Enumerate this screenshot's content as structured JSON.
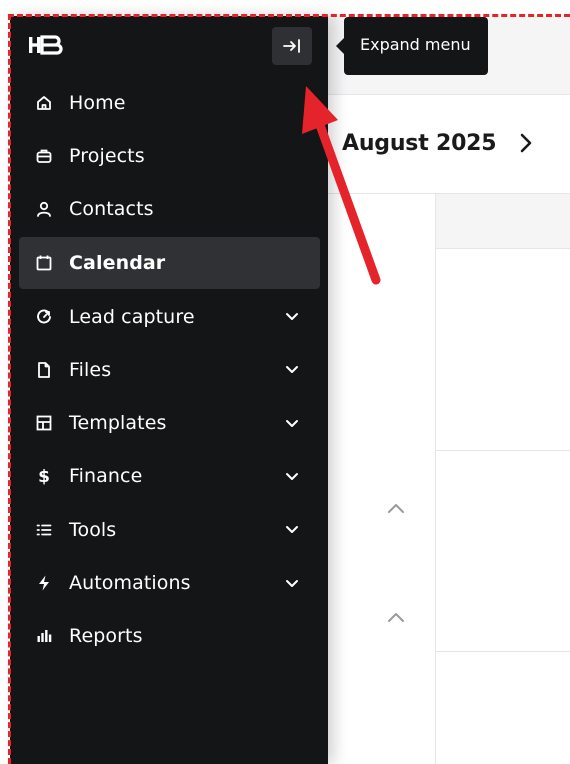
{
  "colors": {
    "sidebar_bg": "#141517",
    "active_bg": "#303135",
    "annotation_red": "#e5232a",
    "text_white": "#ffffff"
  },
  "header": {
    "month": "August 2025",
    "next_icon": "chevron-right-icon"
  },
  "tooltip": {
    "text": "Expand menu"
  },
  "sidebar": {
    "logo": "HB",
    "collapse_icon": "arrow-to-right-icon",
    "items": [
      {
        "label": "Home",
        "icon": "home-icon",
        "active": false,
        "expandable": false
      },
      {
        "label": "Projects",
        "icon": "briefcase-icon",
        "active": false,
        "expandable": false
      },
      {
        "label": "Contacts",
        "icon": "person-icon",
        "active": false,
        "expandable": false
      },
      {
        "label": "Calendar",
        "icon": "calendar-icon",
        "active": true,
        "expandable": false
      },
      {
        "label": "Lead capture",
        "icon": "lead-capture-icon",
        "active": false,
        "expandable": true
      },
      {
        "label": "Files",
        "icon": "file-icon",
        "active": false,
        "expandable": true
      },
      {
        "label": "Templates",
        "icon": "template-icon",
        "active": false,
        "expandable": true
      },
      {
        "label": "Finance",
        "icon": "dollar-icon",
        "active": false,
        "expandable": true
      },
      {
        "label": "Tools",
        "icon": "list-icon",
        "active": false,
        "expandable": true
      },
      {
        "label": "Automations",
        "icon": "lightning-icon",
        "active": false,
        "expandable": true
      },
      {
        "label": "Reports",
        "icon": "bar-chart-icon",
        "active": false,
        "expandable": false
      }
    ]
  }
}
